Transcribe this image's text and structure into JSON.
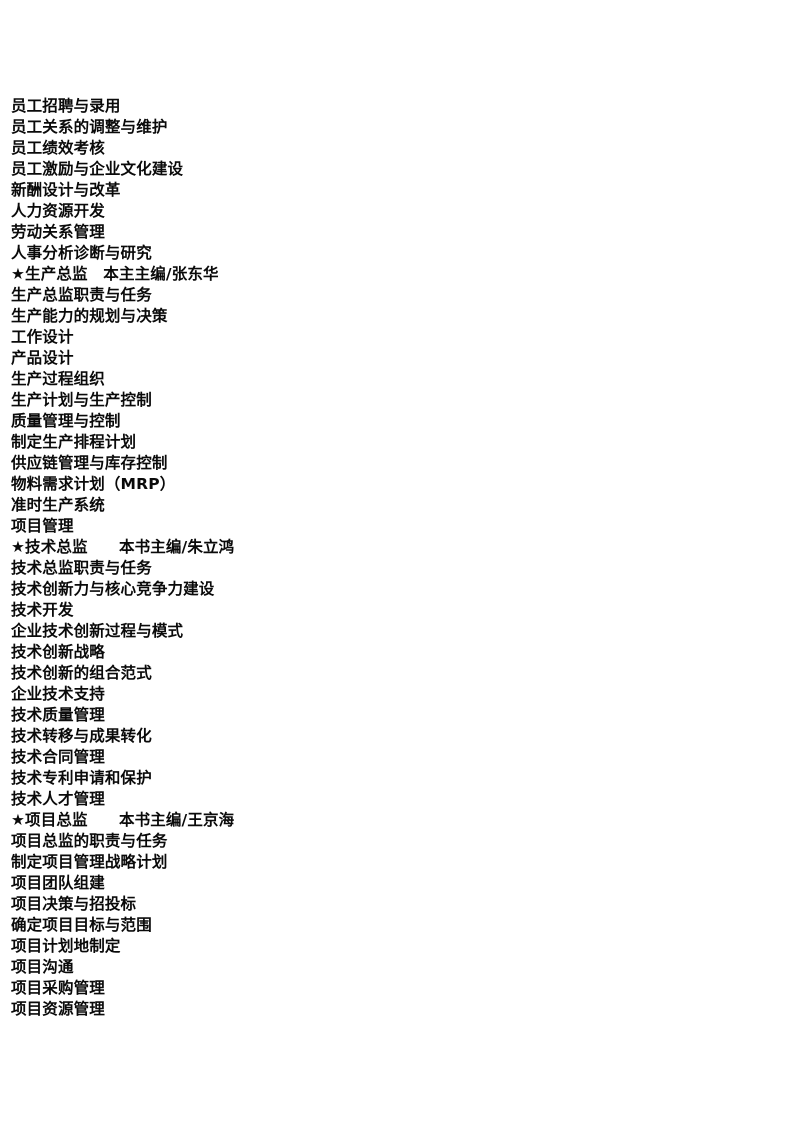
{
  "document": {
    "page_background": "#ffffff",
    "text_color": "#0a0a0a",
    "lines": [
      {
        "text": "员工招聘与录用",
        "heading": false
      },
      {
        "text": "员工关系的调整与维护",
        "heading": false
      },
      {
        "text": "员工绩效考核",
        "heading": false
      },
      {
        "text": "员工激励与企业文化建设",
        "heading": false
      },
      {
        "text": "新酬设计与改革",
        "heading": false
      },
      {
        "text": "人力资源开发",
        "heading": false
      },
      {
        "text": "劳动关系管理",
        "heading": false
      },
      {
        "text": "人事分析诊断与研究",
        "heading": false
      },
      {
        "text": "★生产总监　本主主编/张东华",
        "heading": true
      },
      {
        "text": "生产总监职责与任务",
        "heading": false
      },
      {
        "text": "生产能力的规划与决策",
        "heading": false
      },
      {
        "text": "工作设计",
        "heading": false
      },
      {
        "text": "产品设计",
        "heading": false
      },
      {
        "text": "生产过程组织",
        "heading": false
      },
      {
        "text": "生产计划与生产控制",
        "heading": false
      },
      {
        "text": "质量管理与控制",
        "heading": false
      },
      {
        "text": "制定生产排程计划",
        "heading": false
      },
      {
        "text": "供应链管理与库存控制",
        "heading": false
      },
      {
        "text": "物料需求计划（MRP）",
        "heading": false
      },
      {
        "text": "准时生产系统",
        "heading": false
      },
      {
        "text": "项目管理",
        "heading": false
      },
      {
        "text": "★技术总监　　本书主编/朱立鸿",
        "heading": true
      },
      {
        "text": "技术总监职责与任务",
        "heading": false
      },
      {
        "text": "技术创新力与核心竞争力建设",
        "heading": false
      },
      {
        "text": "技术开发",
        "heading": false
      },
      {
        "text": "企业技术创新过程与模式",
        "heading": false
      },
      {
        "text": "技术创新战略",
        "heading": false
      },
      {
        "text": "技术创新的组合范式",
        "heading": false
      },
      {
        "text": "企业技术支持",
        "heading": false
      },
      {
        "text": "技术质量管理",
        "heading": false
      },
      {
        "text": "技术转移与成果转化",
        "heading": false
      },
      {
        "text": "技术合同管理",
        "heading": false
      },
      {
        "text": "技术专利申请和保护",
        "heading": false
      },
      {
        "text": "技术人才管理",
        "heading": false
      },
      {
        "text": "★项目总监　　本书主编/王京海",
        "heading": true
      },
      {
        "text": "项目总监的职责与任务",
        "heading": false
      },
      {
        "text": "制定项目管理战略计划",
        "heading": false
      },
      {
        "text": "项目团队组建",
        "heading": false
      },
      {
        "text": "项目决策与招投标",
        "heading": false
      },
      {
        "text": "确定项目目标与范围",
        "heading": false
      },
      {
        "text": "项目计划地制定",
        "heading": false
      },
      {
        "text": "项目沟通",
        "heading": false
      },
      {
        "text": "项目采购管理",
        "heading": false
      },
      {
        "text": "项目资源管理",
        "heading": false
      }
    ]
  }
}
